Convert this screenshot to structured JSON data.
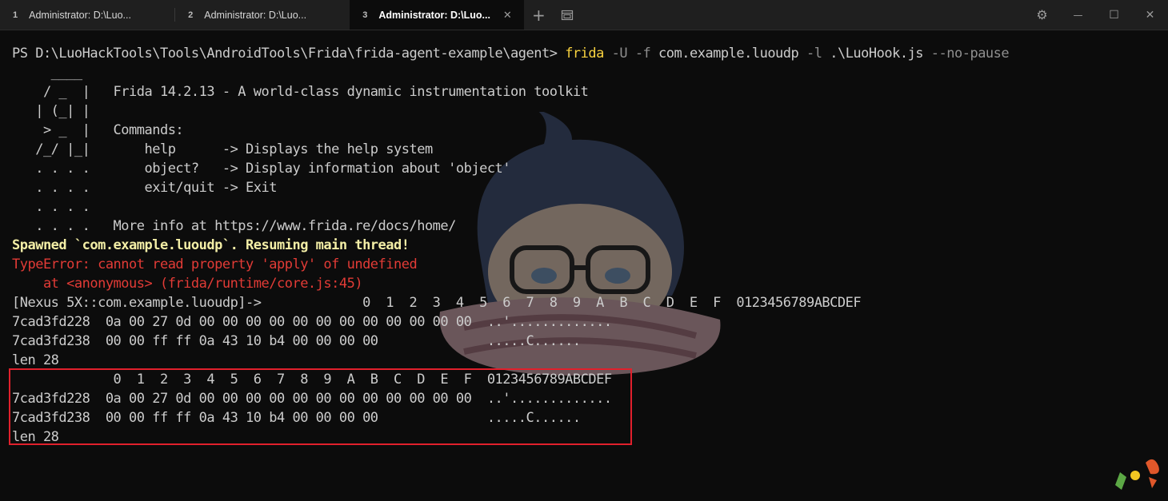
{
  "tabs": [
    {
      "num": "1",
      "title": "Administrator: D:\\Luo...",
      "close": "✕",
      "active": false
    },
    {
      "num": "2",
      "title": "Administrator: D:\\Luo...",
      "close": "✕",
      "active": false
    },
    {
      "num": "3",
      "title": "Administrator: D:\\Luo...",
      "close": "✕",
      "active": true
    }
  ],
  "toolbar": {
    "new_tab": "+",
    "settings": "⚙",
    "minimize": "—",
    "maximize": "☐",
    "close": "✕"
  },
  "terminal": {
    "prompt": {
      "ps": "PS D:\\LuoHackTools\\Tools\\AndroidTools\\Frida\\frida-agent-example\\agent> ",
      "cmd": "frida",
      "args1": " -U -f",
      "pkg": " com.example.luoudp",
      "args2": " -l",
      "script": " .\\LuoHook.js",
      "args3": " --no-pause"
    },
    "banner": [
      "     ____",
      "    / _  |   Frida 14.2.13 - A world-class dynamic instrumentation toolkit",
      "   | (_| |",
      "    > _  |   Commands:",
      "   /_/ |_|       help      -> Displays the help system",
      "   . . . .       object?   -> Display information about 'object'",
      "   . . . .       exit/quit -> Exit",
      "   . . . .",
      "   . . . .   More info at https://www.frida.re/docs/home/"
    ],
    "spawned": "Spawned `com.example.luoudp`. Resuming main thread!",
    "error1": "TypeError: cannot read property 'apply' of undefined",
    "error2": "    at <anonymous> (frida/runtime/core.js:45)",
    "dump1": [
      "[Nexus 5X::com.example.luoudp]->             0  1  2  3  4  5  6  7  8  9  A  B  C  D  E  F  0123456789ABCDEF",
      "7cad3fd228  0a 00 27 0d 00 00 00 00 00 00 00 00 00 00 00 00  ..'.............",
      "7cad3fd238  00 00 ff ff 0a 43 10 b4 00 00 00 00              .....C......",
      "len 28"
    ],
    "dump2": [
      "             0  1  2  3  4  5  6  7  8  9  A  B  C  D  E  F  0123456789ABCDEF",
      "7cad3fd228  0a 00 27 0d 00 00 00 00 00 00 00 00 00 00 00 00  ..'.............",
      "7cad3fd238  00 00 ff ff 0a 43 10 b4 00 00 00 00              .....C......",
      "len 28"
    ]
  },
  "colors": {
    "background": "#0c0c0c",
    "highlight_border": "#e1202c",
    "command": "#f9d23f",
    "error": "#e23b36",
    "spawned": "#f3eea6"
  }
}
